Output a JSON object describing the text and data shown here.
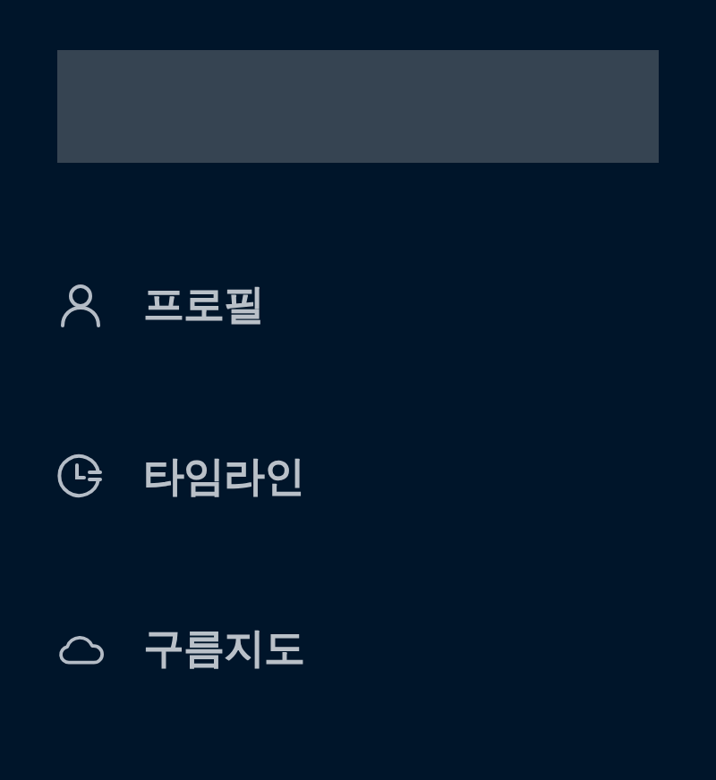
{
  "menu": [
    {
      "kind": "person",
      "label": "프로필"
    },
    {
      "kind": "clock",
      "label": "타임라인"
    },
    {
      "kind": "cloud",
      "label": "구름지도"
    }
  ]
}
